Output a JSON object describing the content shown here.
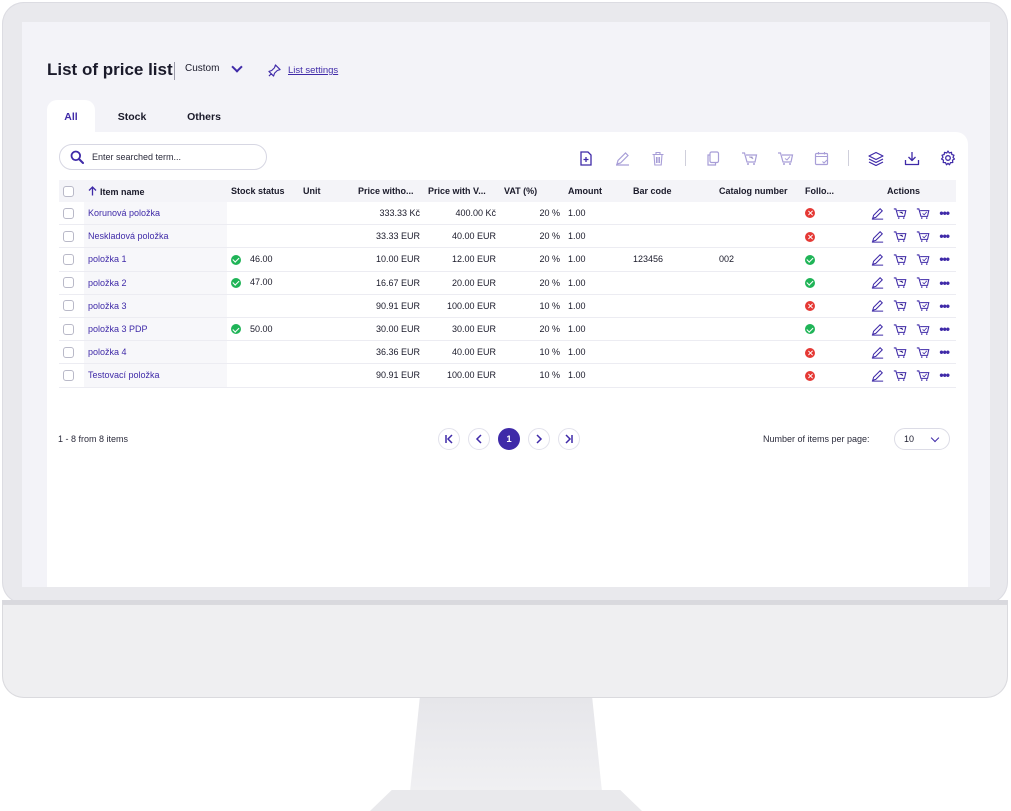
{
  "header": {
    "title": "List of price list",
    "view_select": "Custom",
    "list_settings": "List settings"
  },
  "tabs": [
    {
      "label": "All",
      "active": true
    },
    {
      "label": "Stock",
      "active": false
    },
    {
      "label": "Others",
      "active": false
    }
  ],
  "search": {
    "placeholder": "Enter searched term..."
  },
  "toolbar": {
    "icons": [
      "add-document-icon",
      "edit-icon",
      "trash-icon",
      "copy-icon",
      "tag-cart-icon",
      "cart-icon",
      "calendar-check-icon",
      "layers-icon",
      "download-tray-icon",
      "gear-icon"
    ]
  },
  "table": {
    "columns": [
      "Item name",
      "Stock status",
      "Unit",
      "Price witho...",
      "Price with V...",
      "VAT (%)",
      "Amount",
      "Bar code",
      "Catalog number",
      "Follo...",
      "Actions"
    ],
    "rows": [
      {
        "name": "Korunová položka",
        "stock": "",
        "unit": "",
        "price_without": "333.33 Kč",
        "price_with": "400.00 Kč",
        "vat": "20 %",
        "amount": "1.00",
        "barcode": "",
        "catalog": "",
        "follow": false
      },
      {
        "name": "Neskladová položka",
        "stock": "",
        "unit": "",
        "price_without": "33.33 EUR",
        "price_with": "40.00 EUR",
        "vat": "20 %",
        "amount": "1.00",
        "barcode": "",
        "catalog": "",
        "follow": false
      },
      {
        "name": "položka 1",
        "stock": "46.00",
        "unit": "",
        "price_without": "10.00 EUR",
        "price_with": "12.00 EUR",
        "vat": "20 %",
        "amount": "1.00",
        "barcode": "123456",
        "catalog": "002",
        "follow": true
      },
      {
        "name": "položka 2",
        "stock": "47.00",
        "unit": "",
        "price_without": "16.67 EUR",
        "price_with": "20.00 EUR",
        "vat": "20 %",
        "amount": "1.00",
        "barcode": "",
        "catalog": "",
        "follow": true
      },
      {
        "name": "položka 3",
        "stock": "",
        "unit": "",
        "price_without": "90.91 EUR",
        "price_with": "100.00 EUR",
        "vat": "10 %",
        "amount": "1.00",
        "barcode": "",
        "catalog": "",
        "follow": false
      },
      {
        "name": "položka 3 PDP",
        "stock": "50.00",
        "unit": "",
        "price_without": "30.00 EUR",
        "price_with": "30.00 EUR",
        "vat": "20 %",
        "amount": "1.00",
        "barcode": "",
        "catalog": "",
        "follow": true
      },
      {
        "name": "položka 4",
        "stock": "",
        "unit": "",
        "price_without": "36.36 EUR",
        "price_with": "40.00 EUR",
        "vat": "10 %",
        "amount": "1.00",
        "barcode": "",
        "catalog": "",
        "follow": false
      },
      {
        "name": "Testovací položka",
        "stock": "",
        "unit": "",
        "price_without": "90.91 EUR",
        "price_with": "100.00 EUR",
        "vat": "10 %",
        "amount": "1.00",
        "barcode": "",
        "catalog": "",
        "follow": false
      }
    ]
  },
  "footer": {
    "range": "1 - 8 from 8 items",
    "current_page": "1",
    "per_page_label": "Number of items per page:",
    "per_page": "10"
  },
  "colors": {
    "accent": "#3f2aa8",
    "success": "#1fb457",
    "error": "#e53935"
  }
}
